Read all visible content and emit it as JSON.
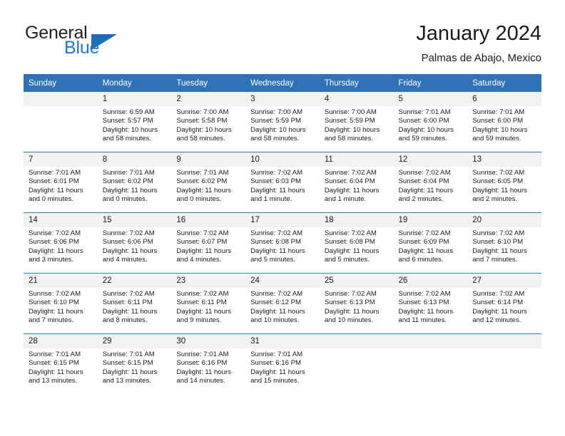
{
  "brand": {
    "name_top": "General",
    "name_bottom": "Blue",
    "triangle_icon": "triangle-icon",
    "color_dark": "#231f20",
    "color_blue": "#2176c7"
  },
  "header": {
    "title": "January 2024",
    "subtitle": "Palmas de Abajo, Mexico"
  },
  "theme": {
    "header_blue": "#2e72b8",
    "band_gray": "#f2f2f2",
    "separator_blue": "#3a7cbe"
  },
  "weekday_headers": [
    "Sunday",
    "Monday",
    "Tuesday",
    "Wednesday",
    "Thursday",
    "Friday",
    "Saturday"
  ],
  "weeks": [
    [
      {
        "day": "",
        "blank": true,
        "sunrise": "",
        "sunset": "",
        "daylight": ""
      },
      {
        "day": "1",
        "sunrise": "Sunrise: 6:59 AM",
        "sunset": "Sunset: 5:57 PM",
        "daylight": "Daylight: 10 hours and 58 minutes."
      },
      {
        "day": "2",
        "sunrise": "Sunrise: 7:00 AM",
        "sunset": "Sunset: 5:58 PM",
        "daylight": "Daylight: 10 hours and 58 minutes."
      },
      {
        "day": "3",
        "sunrise": "Sunrise: 7:00 AM",
        "sunset": "Sunset: 5:59 PM",
        "daylight": "Daylight: 10 hours and 58 minutes."
      },
      {
        "day": "4",
        "sunrise": "Sunrise: 7:00 AM",
        "sunset": "Sunset: 5:59 PM",
        "daylight": "Daylight: 10 hours and 58 minutes."
      },
      {
        "day": "5",
        "sunrise": "Sunrise: 7:01 AM",
        "sunset": "Sunset: 6:00 PM",
        "daylight": "Daylight: 10 hours and 59 minutes."
      },
      {
        "day": "6",
        "sunrise": "Sunrise: 7:01 AM",
        "sunset": "Sunset: 6:00 PM",
        "daylight": "Daylight: 10 hours and 59 minutes."
      }
    ],
    [
      {
        "day": "7",
        "sunrise": "Sunrise: 7:01 AM",
        "sunset": "Sunset: 6:01 PM",
        "daylight": "Daylight: 11 hours and 0 minutes."
      },
      {
        "day": "8",
        "sunrise": "Sunrise: 7:01 AM",
        "sunset": "Sunset: 6:02 PM",
        "daylight": "Daylight: 11 hours and 0 minutes."
      },
      {
        "day": "9",
        "sunrise": "Sunrise: 7:01 AM",
        "sunset": "Sunset: 6:02 PM",
        "daylight": "Daylight: 11 hours and 0 minutes."
      },
      {
        "day": "10",
        "sunrise": "Sunrise: 7:02 AM",
        "sunset": "Sunset: 6:03 PM",
        "daylight": "Daylight: 11 hours and 1 minute."
      },
      {
        "day": "11",
        "sunrise": "Sunrise: 7:02 AM",
        "sunset": "Sunset: 6:04 PM",
        "daylight": "Daylight: 11 hours and 1 minute."
      },
      {
        "day": "12",
        "sunrise": "Sunrise: 7:02 AM",
        "sunset": "Sunset: 6:04 PM",
        "daylight": "Daylight: 11 hours and 2 minutes."
      },
      {
        "day": "13",
        "sunrise": "Sunrise: 7:02 AM",
        "sunset": "Sunset: 6:05 PM",
        "daylight": "Daylight: 11 hours and 2 minutes."
      }
    ],
    [
      {
        "day": "14",
        "sunrise": "Sunrise: 7:02 AM",
        "sunset": "Sunset: 6:06 PM",
        "daylight": "Daylight: 11 hours and 3 minutes."
      },
      {
        "day": "15",
        "sunrise": "Sunrise: 7:02 AM",
        "sunset": "Sunset: 6:06 PM",
        "daylight": "Daylight: 11 hours and 4 minutes."
      },
      {
        "day": "16",
        "sunrise": "Sunrise: 7:02 AM",
        "sunset": "Sunset: 6:07 PM",
        "daylight": "Daylight: 11 hours and 4 minutes."
      },
      {
        "day": "17",
        "sunrise": "Sunrise: 7:02 AM",
        "sunset": "Sunset: 6:08 PM",
        "daylight": "Daylight: 11 hours and 5 minutes."
      },
      {
        "day": "18",
        "sunrise": "Sunrise: 7:02 AM",
        "sunset": "Sunset: 6:08 PM",
        "daylight": "Daylight: 11 hours and 5 minutes."
      },
      {
        "day": "19",
        "sunrise": "Sunrise: 7:02 AM",
        "sunset": "Sunset: 6:09 PM",
        "daylight": "Daylight: 11 hours and 6 minutes."
      },
      {
        "day": "20",
        "sunrise": "Sunrise: 7:02 AM",
        "sunset": "Sunset: 6:10 PM",
        "daylight": "Daylight: 11 hours and 7 minutes."
      }
    ],
    [
      {
        "day": "21",
        "sunrise": "Sunrise: 7:02 AM",
        "sunset": "Sunset: 6:10 PM",
        "daylight": "Daylight: 11 hours and 7 minutes."
      },
      {
        "day": "22",
        "sunrise": "Sunrise: 7:02 AM",
        "sunset": "Sunset: 6:11 PM",
        "daylight": "Daylight: 11 hours and 8 minutes."
      },
      {
        "day": "23",
        "sunrise": "Sunrise: 7:02 AM",
        "sunset": "Sunset: 6:11 PM",
        "daylight": "Daylight: 11 hours and 9 minutes."
      },
      {
        "day": "24",
        "sunrise": "Sunrise: 7:02 AM",
        "sunset": "Sunset: 6:12 PM",
        "daylight": "Daylight: 11 hours and 10 minutes."
      },
      {
        "day": "25",
        "sunrise": "Sunrise: 7:02 AM",
        "sunset": "Sunset: 6:13 PM",
        "daylight": "Daylight: 11 hours and 10 minutes."
      },
      {
        "day": "26",
        "sunrise": "Sunrise: 7:02 AM",
        "sunset": "Sunset: 6:13 PM",
        "daylight": "Daylight: 11 hours and 11 minutes."
      },
      {
        "day": "27",
        "sunrise": "Sunrise: 7:02 AM",
        "sunset": "Sunset: 6:14 PM",
        "daylight": "Daylight: 11 hours and 12 minutes."
      }
    ],
    [
      {
        "day": "28",
        "sunrise": "Sunrise: 7:01 AM",
        "sunset": "Sunset: 6:15 PM",
        "daylight": "Daylight: 11 hours and 13 minutes."
      },
      {
        "day": "29",
        "sunrise": "Sunrise: 7:01 AM",
        "sunset": "Sunset: 6:15 PM",
        "daylight": "Daylight: 11 hours and 13 minutes."
      },
      {
        "day": "30",
        "sunrise": "Sunrise: 7:01 AM",
        "sunset": "Sunset: 6:16 PM",
        "daylight": "Daylight: 11 hours and 14 minutes."
      },
      {
        "day": "31",
        "sunrise": "Sunrise: 7:01 AM",
        "sunset": "Sunset: 6:16 PM",
        "daylight": "Daylight: 11 hours and 15 minutes."
      },
      {
        "day": "",
        "blank": true,
        "sunrise": "",
        "sunset": "",
        "daylight": ""
      },
      {
        "day": "",
        "blank": true,
        "sunrise": "",
        "sunset": "",
        "daylight": ""
      },
      {
        "day": "",
        "blank": true,
        "sunrise": "",
        "sunset": "",
        "daylight": ""
      }
    ]
  ]
}
